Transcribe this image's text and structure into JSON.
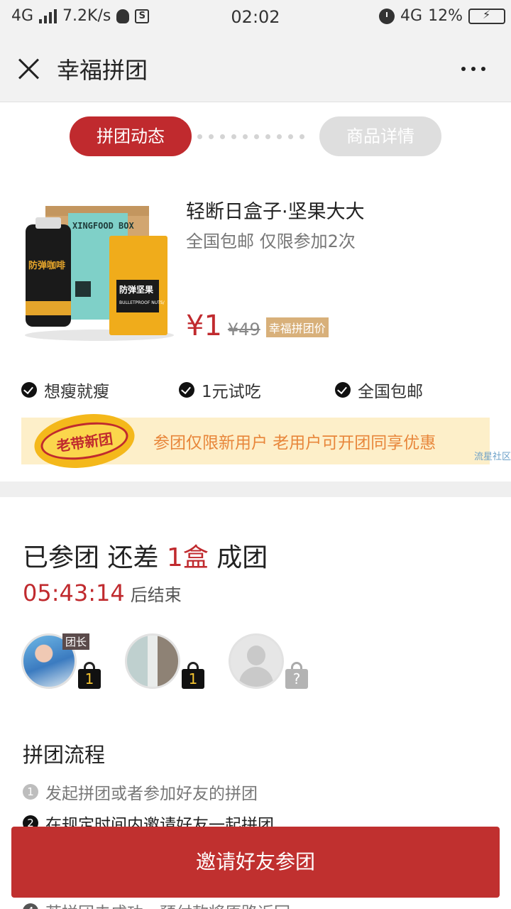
{
  "status_bar": {
    "network": "4G",
    "speed": "7.2K/s",
    "time": "02:02",
    "network_right": "4G",
    "battery": "12%"
  },
  "header": {
    "title": "幸福拼团"
  },
  "tabs": [
    {
      "label": "拼团动态",
      "active": true
    },
    {
      "label": "商品详情",
      "active": false
    }
  ],
  "product": {
    "name": "轻断日盒子·坚果大大",
    "subtitle": "全国包邮 仅限参加2次",
    "price": "¥1",
    "original_price": "¥49",
    "price_tag": "幸福拼团价",
    "image_texts": {
      "box": "XINGFOOD BOX",
      "can": "防弹咖啡",
      "bag": "防弹坚果",
      "bag_sub": "BULLETPROOF NUTS/"
    }
  },
  "features": [
    "想瘦就瘦",
    "1元试吃",
    "全国包邮"
  ],
  "banner": {
    "badge": "老带新团",
    "text": "参团仅限新用户 老用户可开团同享优惠",
    "watermark": "流星社区"
  },
  "group": {
    "title_pre": "已参团 还差 ",
    "title_highlight": "1盒",
    "title_post": " 成团",
    "timer": "05:43:14",
    "timer_suffix": "后结束",
    "leader_tag": "团长",
    "members": [
      {
        "count": "1"
      },
      {
        "count": "1"
      },
      {
        "count": "?"
      }
    ]
  },
  "process": {
    "title": "拼团流程",
    "steps": [
      {
        "num": "1",
        "text": "发起拼团或者参加好友的拼团"
      },
      {
        "num": "2",
        "text": "在规定时间内邀请好友一起拼团"
      },
      {
        "num": "4",
        "text": "若拼团未成功，预付款将原路返回"
      }
    ]
  },
  "cta": {
    "label": "邀请好友参团"
  },
  "colors": {
    "accent": "#c02a2e",
    "banner_bg": "#fdefc9",
    "banner_text": "#e8863a"
  }
}
